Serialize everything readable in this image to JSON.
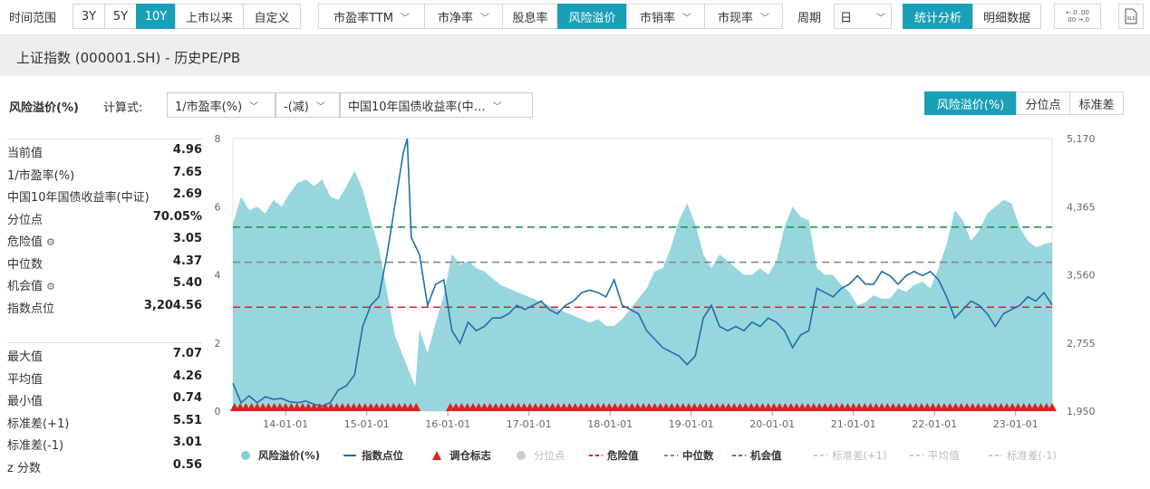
{
  "toolbar": {
    "range_label": "时间范围",
    "range_buttons": [
      "3Y",
      "5Y",
      "10Y",
      "上市以来",
      "自定义"
    ],
    "metric_buttons": [
      "市盈率TTM",
      "市净率",
      "股息率",
      "风险溢价",
      "市销率",
      "市现率"
    ],
    "period_label": "周期",
    "period_value": "日",
    "view_buttons": [
      "统计分析",
      "明细数据"
    ]
  },
  "title": "上证指数 (000001.SH) - 历史PE/PB",
  "controls": {
    "metric_label": "风险溢价(%)",
    "formula_label": "计算式:",
    "operand1": "1/市盈率(%)",
    "operator": "-(减)",
    "operand2": "中国10年国债收益率(中…",
    "mode_buttons": [
      "风险溢价(%)",
      "分位点",
      "标准差"
    ]
  },
  "stats_top": [
    {
      "k": "当前值",
      "v": "4.96"
    },
    {
      "k": "1/市盈率(%)",
      "v": "7.65"
    },
    {
      "k": "中国10年国债收益率(中证)",
      "v": "2.69"
    },
    {
      "k": "分位点",
      "v": "70.05%"
    },
    {
      "k": "危险值",
      "v": "3.05"
    },
    {
      "k": "中位数",
      "v": "4.37"
    },
    {
      "k": "机会值",
      "v": "5.40"
    },
    {
      "k": "指数点位",
      "v": "3,204.56"
    }
  ],
  "stats_bottom": [
    {
      "k": "最大值",
      "v": "7.07"
    },
    {
      "k": "平均值",
      "v": "4.26"
    },
    {
      "k": "最小值",
      "v": "0.74"
    },
    {
      "k": "标准差(+1)",
      "v": "5.51"
    },
    {
      "k": "标准差(-1)",
      "v": "3.01"
    },
    {
      "k": "z 分数",
      "v": "0.56"
    }
  ],
  "chart_data": {
    "type": "area",
    "x_ticks": [
      "14-01-01",
      "15-01-01",
      "16-01-01",
      "17-01-01",
      "18-01-01",
      "19-01-01",
      "20-01-01",
      "21-01-01",
      "22-01-01",
      "23-01-01"
    ],
    "x_range": [
      2013.35,
      2023.45
    ],
    "y_left": {
      "ticks": [
        "0",
        "2",
        "4",
        "6",
        "8"
      ],
      "range": [
        0,
        8
      ]
    },
    "y_right": {
      "ticks": [
        "1,950",
        "2,755",
        "3,560",
        "4,365",
        "5,170"
      ],
      "range": [
        1950,
        5170
      ]
    },
    "reference_lines": [
      {
        "name": "危险值",
        "value": 3.05,
        "color": "#e02020"
      },
      {
        "name": "中位数",
        "value": 4.37,
        "color": "#888888"
      },
      {
        "name": "机会值",
        "value": 5.4,
        "color": "#1a9a4a"
      }
    ],
    "series": [
      {
        "name": "风险溢价(%)",
        "axis": "left",
        "color": "#86cfd8",
        "points": [
          [
            2013.35,
            5.5
          ],
          [
            2013.45,
            6.3
          ],
          [
            2013.55,
            5.9
          ],
          [
            2013.65,
            6.0
          ],
          [
            2013.75,
            5.8
          ],
          [
            2013.85,
            6.2
          ],
          [
            2013.95,
            6.0
          ],
          [
            2014.05,
            6.4
          ],
          [
            2014.15,
            6.7
          ],
          [
            2014.25,
            6.8
          ],
          [
            2014.35,
            6.6
          ],
          [
            2014.45,
            6.8
          ],
          [
            2014.55,
            6.3
          ],
          [
            2014.65,
            6.2
          ],
          [
            2014.75,
            6.6
          ],
          [
            2014.85,
            7.05
          ],
          [
            2014.95,
            6.5
          ],
          [
            2015.05,
            5.6
          ],
          [
            2015.15,
            4.8
          ],
          [
            2015.25,
            3.5
          ],
          [
            2015.35,
            2.2
          ],
          [
            2015.45,
            1.6
          ],
          [
            2015.55,
            1.0
          ],
          [
            2015.6,
            0.74
          ],
          [
            2015.65,
            2.4
          ],
          [
            2015.75,
            1.7
          ],
          [
            2015.85,
            2.6
          ],
          [
            2015.95,
            3.4
          ],
          [
            2016.05,
            4.6
          ],
          [
            2016.15,
            4.3
          ],
          [
            2016.25,
            4.4
          ],
          [
            2016.35,
            4.2
          ],
          [
            2016.45,
            4.1
          ],
          [
            2016.55,
            3.9
          ],
          [
            2016.65,
            3.7
          ],
          [
            2016.75,
            3.6
          ],
          [
            2016.85,
            3.5
          ],
          [
            2016.95,
            3.4
          ],
          [
            2017.05,
            3.3
          ],
          [
            2017.15,
            3.2
          ],
          [
            2017.25,
            3.1
          ],
          [
            2017.35,
            3.0
          ],
          [
            2017.45,
            2.9
          ],
          [
            2017.55,
            2.8
          ],
          [
            2017.65,
            2.7
          ],
          [
            2017.75,
            2.6
          ],
          [
            2017.85,
            2.7
          ],
          [
            2017.95,
            2.5
          ],
          [
            2018.05,
            2.5
          ],
          [
            2018.15,
            2.7
          ],
          [
            2018.25,
            3.0
          ],
          [
            2018.35,
            3.3
          ],
          [
            2018.45,
            3.6
          ],
          [
            2018.55,
            4.1
          ],
          [
            2018.65,
            4.2
          ],
          [
            2018.75,
            4.8
          ],
          [
            2018.85,
            5.6
          ],
          [
            2018.95,
            6.1
          ],
          [
            2019.05,
            5.5
          ],
          [
            2019.15,
            4.6
          ],
          [
            2019.25,
            4.2
          ],
          [
            2019.35,
            4.6
          ],
          [
            2019.45,
            4.4
          ],
          [
            2019.55,
            4.2
          ],
          [
            2019.65,
            4.0
          ],
          [
            2019.75,
            4.0
          ],
          [
            2019.85,
            4.2
          ],
          [
            2019.95,
            4.0
          ],
          [
            2020.05,
            4.4
          ],
          [
            2020.15,
            5.4
          ],
          [
            2020.25,
            6.0
          ],
          [
            2020.35,
            5.7
          ],
          [
            2020.45,
            5.6
          ],
          [
            2020.55,
            4.2
          ],
          [
            2020.65,
            4.0
          ],
          [
            2020.75,
            4.0
          ],
          [
            2020.85,
            3.7
          ],
          [
            2020.95,
            3.5
          ],
          [
            2021.05,
            3.1
          ],
          [
            2021.15,
            3.2
          ],
          [
            2021.25,
            3.4
          ],
          [
            2021.35,
            3.3
          ],
          [
            2021.45,
            3.3
          ],
          [
            2021.55,
            3.6
          ],
          [
            2021.65,
            3.5
          ],
          [
            2021.75,
            3.7
          ],
          [
            2021.85,
            3.8
          ],
          [
            2021.95,
            3.6
          ],
          [
            2022.05,
            4.2
          ],
          [
            2022.15,
            4.9
          ],
          [
            2022.25,
            5.9
          ],
          [
            2022.35,
            5.6
          ],
          [
            2022.45,
            5.0
          ],
          [
            2022.55,
            5.3
          ],
          [
            2022.65,
            5.8
          ],
          [
            2022.75,
            6.0
          ],
          [
            2022.85,
            6.2
          ],
          [
            2022.95,
            6.1
          ],
          [
            2023.05,
            5.4
          ],
          [
            2023.15,
            5.0
          ],
          [
            2023.25,
            4.8
          ],
          [
            2023.35,
            4.9
          ],
          [
            2023.45,
            4.96
          ]
        ]
      },
      {
        "name": "指数点位",
        "axis": "right",
        "color": "#1f6fa8",
        "points": [
          [
            2013.35,
            2280
          ],
          [
            2013.45,
            2050
          ],
          [
            2013.55,
            2130
          ],
          [
            2013.65,
            2050
          ],
          [
            2013.75,
            2120
          ],
          [
            2013.85,
            2090
          ],
          [
            2013.95,
            2100
          ],
          [
            2014.05,
            2060
          ],
          [
            2014.15,
            2050
          ],
          [
            2014.25,
            2070
          ],
          [
            2014.35,
            2030
          ],
          [
            2014.45,
            2010
          ],
          [
            2014.55,
            2050
          ],
          [
            2014.65,
            2200
          ],
          [
            2014.75,
            2250
          ],
          [
            2014.85,
            2380
          ],
          [
            2014.95,
            2950
          ],
          [
            2015.05,
            3200
          ],
          [
            2015.15,
            3300
          ],
          [
            2015.25,
            3800
          ],
          [
            2015.35,
            4400
          ],
          [
            2015.45,
            5000
          ],
          [
            2015.5,
            5170
          ],
          [
            2015.55,
            4000
          ],
          [
            2015.65,
            3800
          ],
          [
            2015.75,
            3200
          ],
          [
            2015.85,
            3450
          ],
          [
            2015.95,
            3500
          ],
          [
            2016.05,
            2900
          ],
          [
            2016.15,
            2750
          ],
          [
            2016.25,
            3000
          ],
          [
            2016.35,
            2900
          ],
          [
            2016.45,
            2950
          ],
          [
            2016.55,
            3050
          ],
          [
            2016.65,
            3050
          ],
          [
            2016.75,
            3100
          ],
          [
            2016.85,
            3200
          ],
          [
            2016.95,
            3150
          ],
          [
            2017.05,
            3200
          ],
          [
            2017.15,
            3250
          ],
          [
            2017.25,
            3150
          ],
          [
            2017.35,
            3100
          ],
          [
            2017.45,
            3200
          ],
          [
            2017.55,
            3250
          ],
          [
            2017.65,
            3350
          ],
          [
            2017.75,
            3380
          ],
          [
            2017.85,
            3350
          ],
          [
            2017.95,
            3300
          ],
          [
            2018.05,
            3500
          ],
          [
            2018.15,
            3200
          ],
          [
            2018.25,
            3150
          ],
          [
            2018.35,
            3100
          ],
          [
            2018.45,
            2900
          ],
          [
            2018.55,
            2800
          ],
          [
            2018.65,
            2700
          ],
          [
            2018.75,
            2650
          ],
          [
            2018.85,
            2600
          ],
          [
            2018.95,
            2500
          ],
          [
            2019.05,
            2600
          ],
          [
            2019.15,
            3050
          ],
          [
            2019.25,
            3200
          ],
          [
            2019.35,
            2950
          ],
          [
            2019.45,
            2900
          ],
          [
            2019.55,
            2950
          ],
          [
            2019.65,
            2900
          ],
          [
            2019.75,
            3000
          ],
          [
            2019.85,
            2950
          ],
          [
            2019.95,
            3050
          ],
          [
            2020.05,
            3000
          ],
          [
            2020.15,
            2900
          ],
          [
            2020.25,
            2700
          ],
          [
            2020.35,
            2850
          ],
          [
            2020.45,
            2900
          ],
          [
            2020.55,
            3400
          ],
          [
            2020.65,
            3350
          ],
          [
            2020.75,
            3300
          ],
          [
            2020.85,
            3400
          ],
          [
            2020.95,
            3450
          ],
          [
            2021.05,
            3550
          ],
          [
            2021.15,
            3450
          ],
          [
            2021.25,
            3450
          ],
          [
            2021.35,
            3600
          ],
          [
            2021.45,
            3550
          ],
          [
            2021.55,
            3450
          ],
          [
            2021.65,
            3550
          ],
          [
            2021.75,
            3600
          ],
          [
            2021.85,
            3550
          ],
          [
            2021.95,
            3600
          ],
          [
            2022.05,
            3500
          ],
          [
            2022.15,
            3300
          ],
          [
            2022.25,
            3050
          ],
          [
            2022.35,
            3150
          ],
          [
            2022.45,
            3250
          ],
          [
            2022.55,
            3200
          ],
          [
            2022.65,
            3100
          ],
          [
            2022.75,
            2950
          ],
          [
            2022.85,
            3100
          ],
          [
            2022.95,
            3150
          ],
          [
            2023.05,
            3200
          ],
          [
            2023.15,
            3300
          ],
          [
            2023.25,
            3250
          ],
          [
            2023.35,
            3350
          ],
          [
            2023.45,
            3205
          ]
        ]
      }
    ],
    "legend": [
      {
        "label": "风险溢价(%)",
        "marker": "circle",
        "color": "#86cfd8",
        "enabled": true
      },
      {
        "label": "指数点位",
        "marker": "line",
        "color": "#1f6fa8",
        "enabled": true
      },
      {
        "label": "调仓标志",
        "marker": "triangle",
        "color": "#e02020",
        "enabled": true
      },
      {
        "label": "分位点",
        "marker": "circle",
        "color": "#cccccc",
        "enabled": false
      },
      {
        "label": "危险值",
        "marker": "dash",
        "color": "#e02020",
        "enabled": true
      },
      {
        "label": "中位数",
        "marker": "dash",
        "color": "#888888",
        "enabled": true
      },
      {
        "label": "机会值",
        "marker": "dash",
        "color": "#1a9a4a",
        "enabled": true
      },
      {
        "label": "标准差(+1)",
        "marker": "dash",
        "color": "#cccccc",
        "enabled": false
      },
      {
        "label": "平均值",
        "marker": "dash",
        "color": "#cccccc",
        "enabled": false
      },
      {
        "label": "标准差(-1)",
        "marker": "dash",
        "color": "#cccccc",
        "enabled": false
      }
    ],
    "marker_gaps": [
      [
        2015.65,
        2015.97
      ]
    ]
  }
}
